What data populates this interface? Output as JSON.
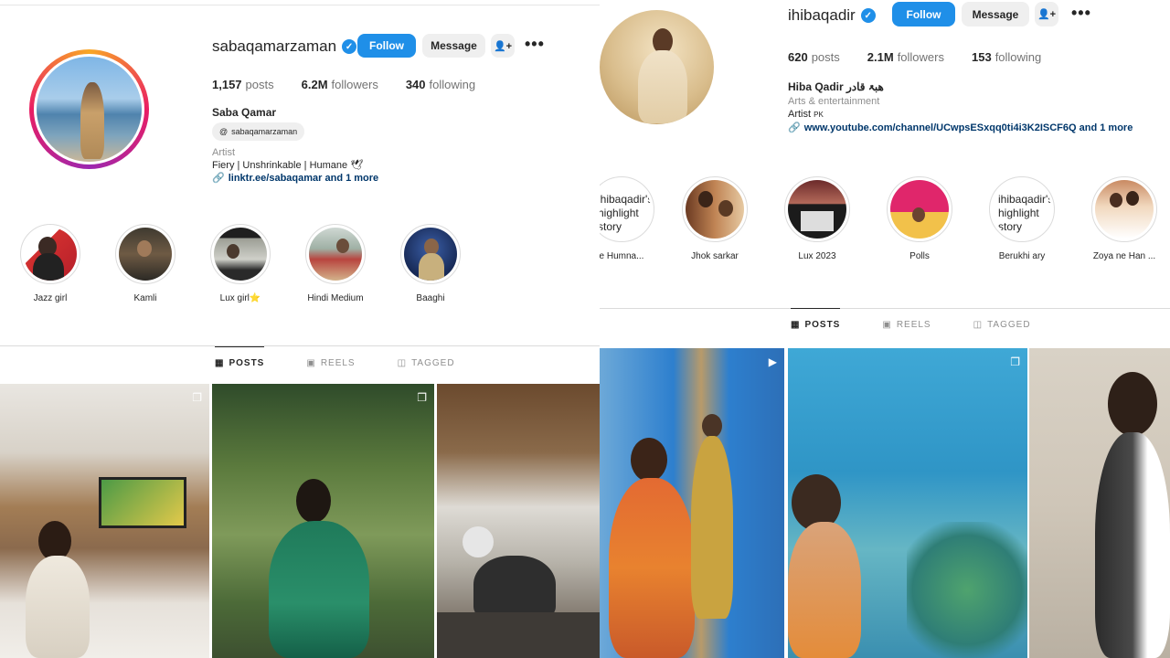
{
  "left": {
    "username": "sabaqamarzaman",
    "follow_label": "Follow",
    "message_label": "Message",
    "add_user_icon": "add-user-icon",
    "more_label": "•••",
    "stats": {
      "posts_value": "1,157",
      "posts_label": "posts",
      "followers_value": "6.2M",
      "followers_label": "followers",
      "following_value": "340",
      "following_label": "following"
    },
    "bio": {
      "name": "Saba Qamar",
      "threads_handle": "sabaqamarzaman",
      "category": "Artist",
      "tagline": "Fiery | Unshrinkable | Humane 🕊",
      "link": "linktr.ee/sabaqamar and 1 more"
    },
    "highlights": [
      {
        "label": "Jazz girl"
      },
      {
        "label": "Kamli"
      },
      {
        "label": "Lux girl⭐"
      },
      {
        "label": "Hindi Medium"
      },
      {
        "label": "Baaghi"
      }
    ],
    "tabs": {
      "posts": "POSTS",
      "reels": "REELS",
      "tagged": "TAGGED"
    }
  },
  "right": {
    "username": "ihibaqadir",
    "follow_label": "Follow",
    "message_label": "Message",
    "more_label": "•••",
    "stats": {
      "posts_value": "620",
      "posts_label": "posts",
      "followers_value": "2.1M",
      "followers_label": "followers",
      "following_value": "153",
      "following_label": "following"
    },
    "bio": {
      "name": "Hiba Qadir هبۃ قادر",
      "category": "Arts & entertainment",
      "artist": "Artist",
      "country": "PK",
      "link": "www.youtube.com/channel/UCwpsESxqq0ti4i3K2ISCF6Q and 1 more"
    },
    "highlights": [
      {
        "label": "e Humna...",
        "cover": "ihibaqadir's highlight story"
      },
      {
        "label": "Jhok sarkar"
      },
      {
        "label": "Lux 2023"
      },
      {
        "label": "Polls"
      },
      {
        "label": "Berukhi ary",
        "cover": "ihibaqadir's highlight story"
      },
      {
        "label": "Zoya ne Han ..."
      }
    ],
    "tabs": {
      "posts": "POSTS",
      "reels": "REELS",
      "tagged": "TAGGED"
    }
  },
  "colors": {
    "accent": "#1f8fe8",
    "link": "#00376b",
    "muted": "#8e8e8e"
  }
}
